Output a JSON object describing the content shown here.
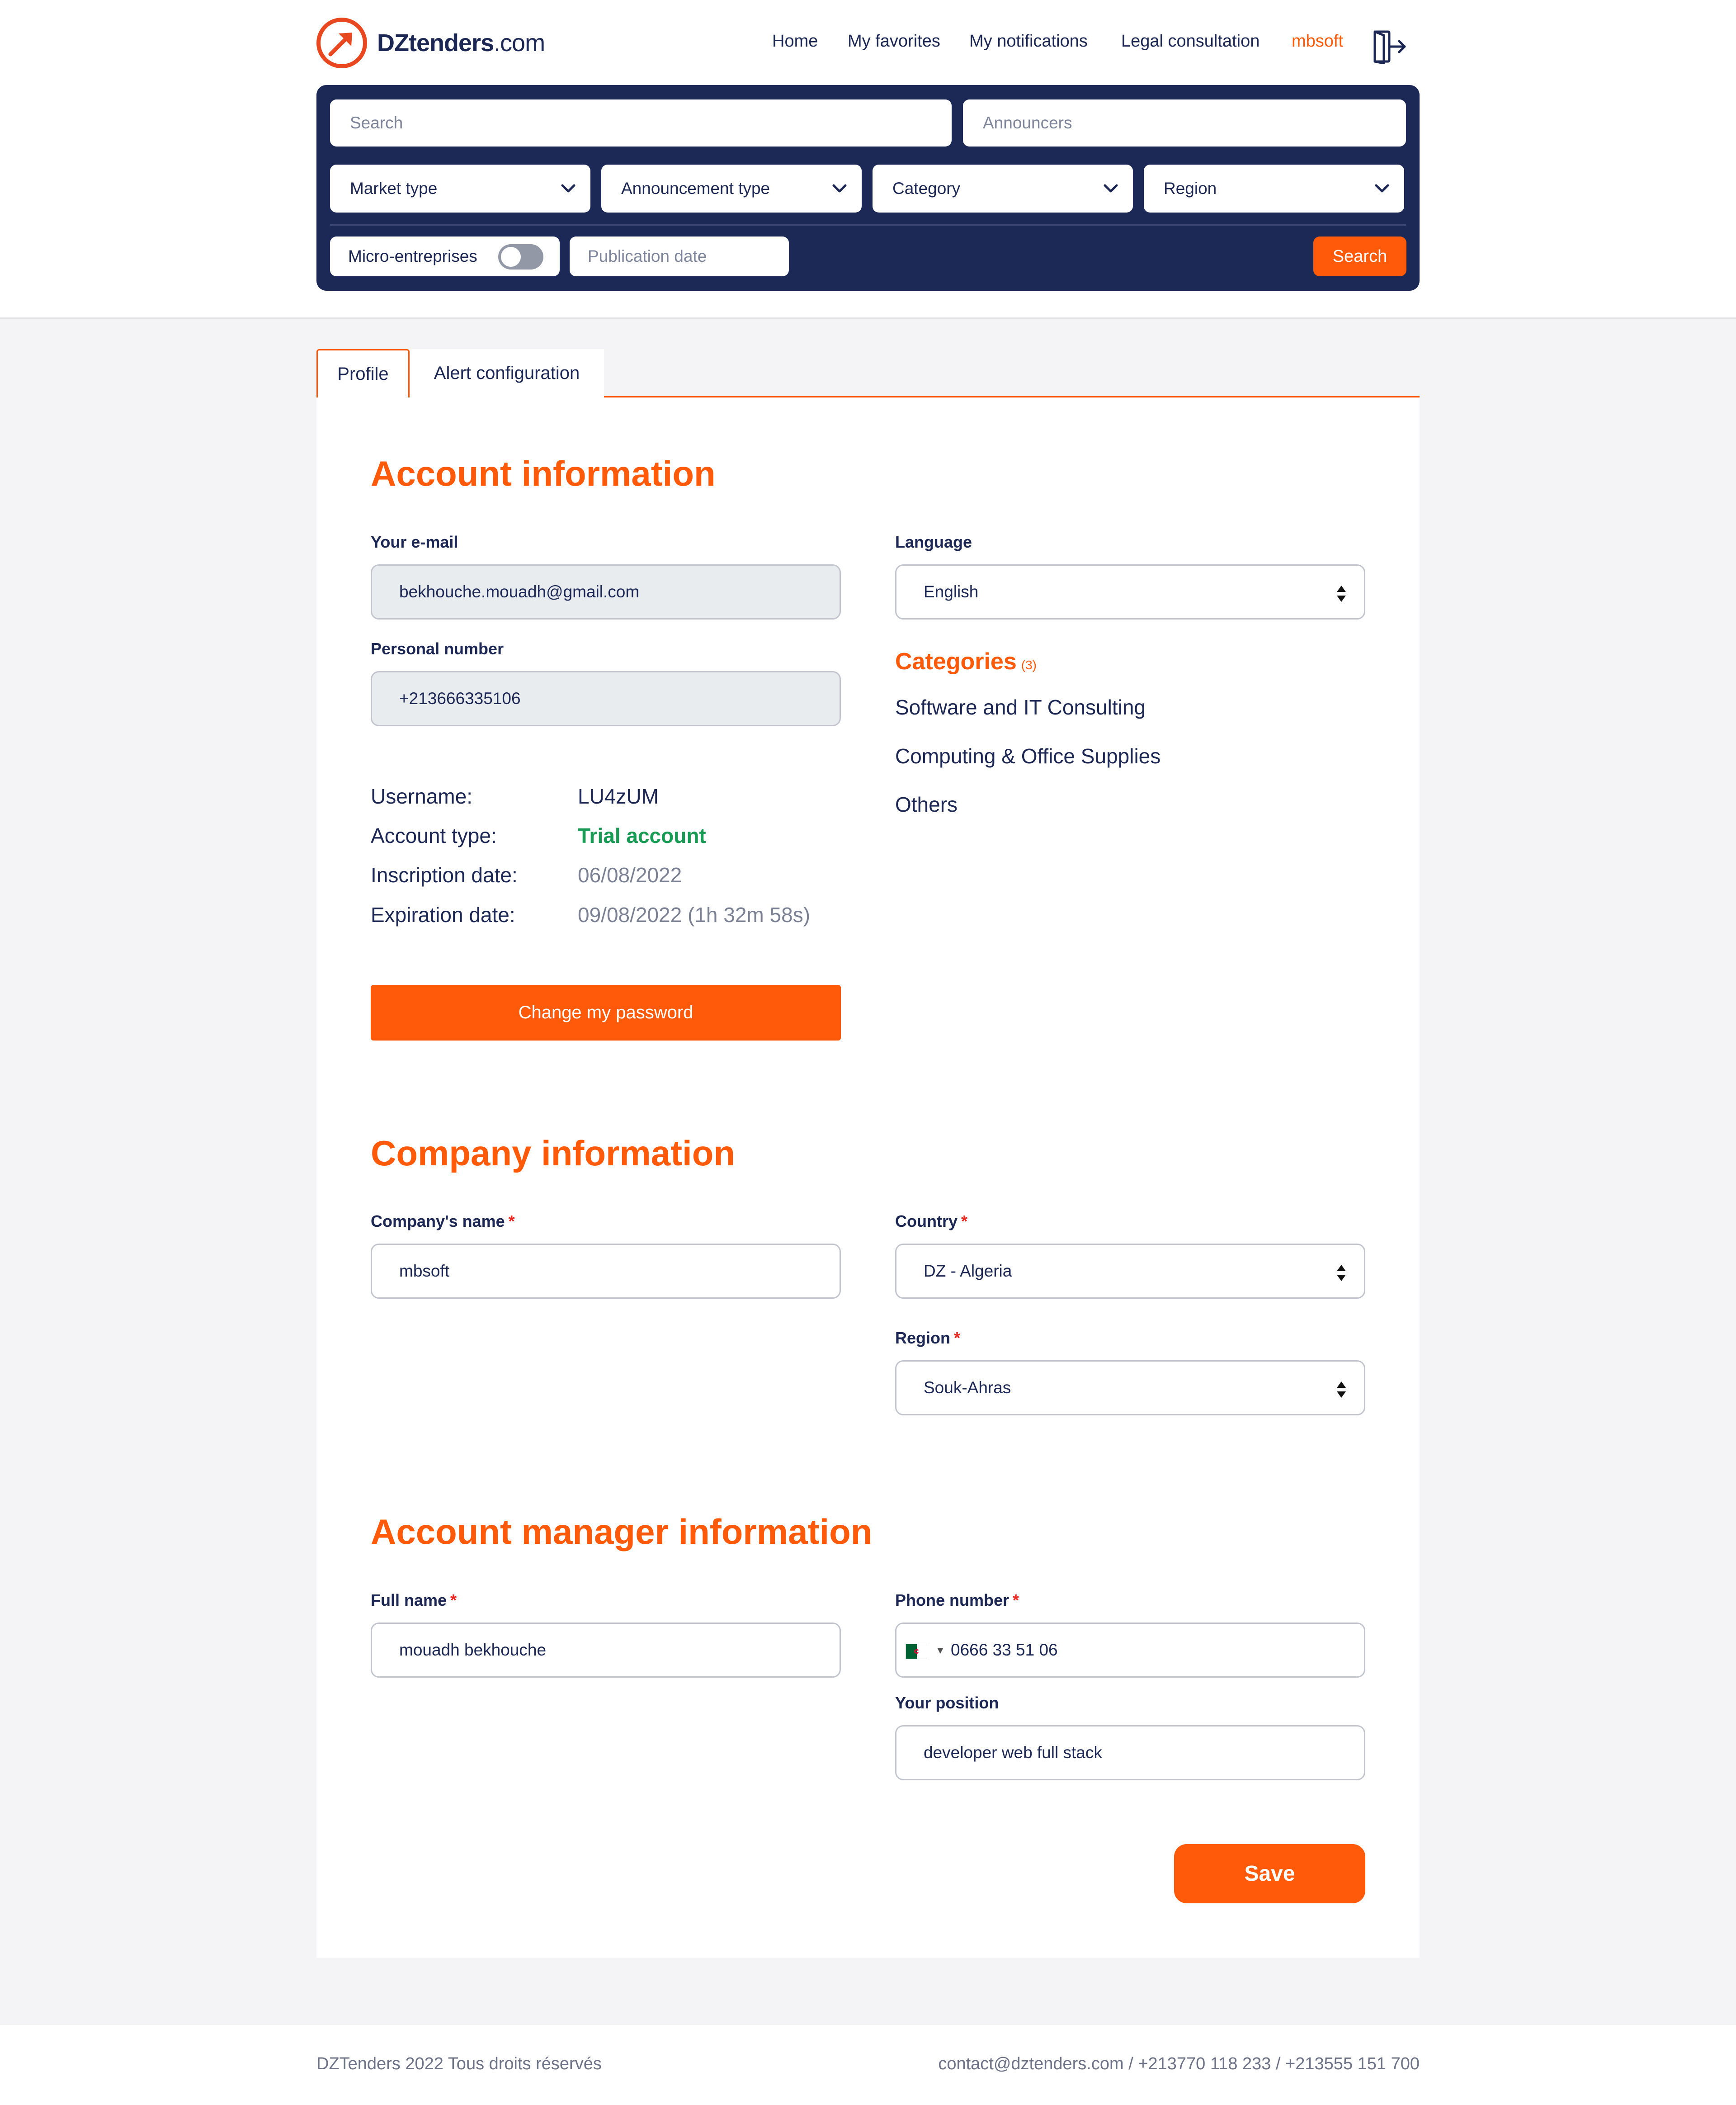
{
  "brand": {
    "name": "DZtenders",
    "domain": ".com",
    "accent": "#ff5a0a",
    "navy": "#1c2856"
  },
  "nav": {
    "home": "Home",
    "favorites": "My favorites",
    "notifications": "My notifications",
    "legal": "Legal consultation",
    "user": "mbsoft",
    "logout_icon": "logout-icon"
  },
  "search": {
    "search_placeholder": "Search",
    "announcers_placeholder": "Announcers",
    "market_type": "Market type",
    "announcement_type": "Announcement type",
    "category": "Category",
    "region": "Region",
    "micro": "Micro-entreprises",
    "micro_enabled": false,
    "publication_date": "Publication date",
    "button": "Search"
  },
  "tabs": {
    "profile": "Profile",
    "alerts": "Alert configuration"
  },
  "account": {
    "title": "Account information",
    "email_label": "Your e-mail",
    "email_value": "bekhouche.mouadh@gmail.com",
    "phone_label": "Personal number",
    "phone_value": "+213666335106",
    "username_key": "Username:",
    "username_val": "LU4zUM",
    "type_key": "Account type:",
    "type_val": "Trial account",
    "inscription_key": "Inscription date:",
    "inscription_val": "06/08/2022",
    "expiration_key": "Expiration date:",
    "expiration_val": "09/08/2022 (1h 32m 58s)",
    "password_button": "Change my password",
    "language_label": "Language",
    "language_value": "English",
    "categories_title": "Categories",
    "categories_count": "(3)",
    "categories": [
      "Software and IT Consulting",
      "Computing & Office Supplies",
      "Others"
    ]
  },
  "company": {
    "title": "Company information",
    "name_label": "Company's name",
    "name_value": "mbsoft",
    "country_label": "Country",
    "country_value": "DZ - Algeria",
    "region_label": "Region",
    "region_value": "Souk-Ahras",
    "required_mark": "*"
  },
  "manager": {
    "title": "Account manager information",
    "fullname_label": "Full name",
    "fullname_value": "mouadh bekhouche",
    "phone_label": "Phone number",
    "phone_value": "0666 33 51 06",
    "position_label": "Your position",
    "position_value": "developer web full stack",
    "save_button": "Save"
  },
  "footer": {
    "copyright": "DZTenders 2022 Tous droits réservés",
    "contact": "contact@dztenders.com / +213770 118 233 / +213555 151 700"
  }
}
